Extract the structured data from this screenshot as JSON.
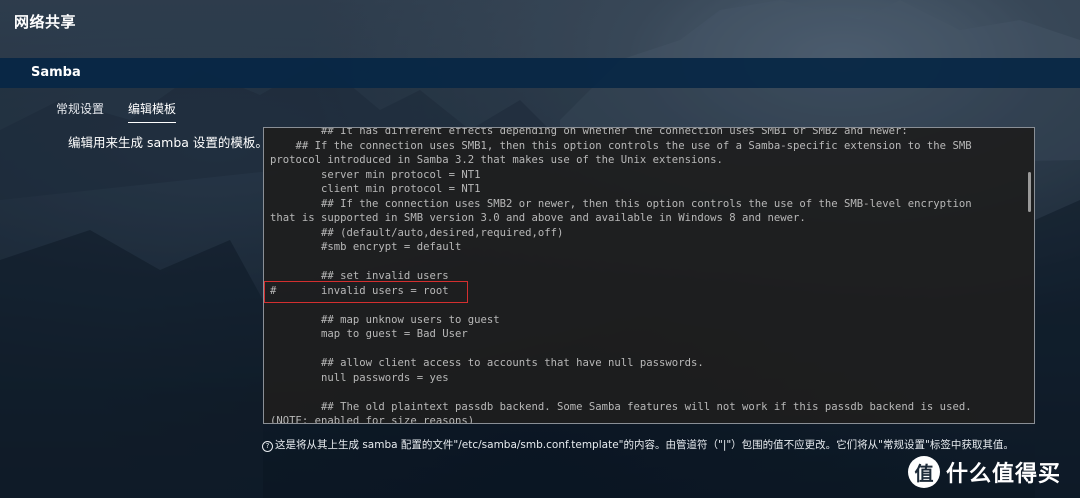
{
  "page": {
    "title": "网络共享"
  },
  "section": {
    "title": "Samba"
  },
  "tabs": [
    {
      "label": "常规设置",
      "active": false
    },
    {
      "label": "编辑模板",
      "active": true
    }
  ],
  "editor": {
    "description": "编辑用来生成 samba 设置的模板。",
    "content": "        ## It has different effects depending on whether the connection uses SMB1 or SMB2 and newer:\n    ## If the connection uses SMB1, then this option controls the use of a Samba-specific extension to the SMB\nprotocol introduced in Samba 3.2 that makes use of the Unix extensions.\n        server min protocol = NT1\n        client min protocol = NT1\n        ## If the connection uses SMB2 or newer, then this option controls the use of the SMB-level encryption\nthat is supported in SMB version 3.0 and above and available in Windows 8 and newer.\n        ## (default/auto,desired,required,off)\n        #smb encrypt = default\n\n        ## set invalid users\n#       invalid users = root\n\n        ## map unknow users to guest\n        map to guest = Bad User\n\n        ## allow client access to accounts that have null passwords.\n        null passwords = yes\n\n        ## The old plaintext passdb backend. Some Samba features will not work if this passdb backend is used.\n(NOTE: enabled for size reasons)"
  },
  "footnote": {
    "icon": "info-icon",
    "text": "这是将从其上生成 samba 配置的文件\"/etc/samba/smb.conf.template\"的内容。由管道符（\"|\"）包围的值不应更改。它们将从\"常规设置\"标签中获取其值。"
  },
  "watermark": {
    "badge": "值",
    "text": "什么值得买"
  },
  "colors": {
    "header_bar": "#06264a",
    "highlight_box": "#d32f2f",
    "editor_bg": "#1e1e1e"
  }
}
